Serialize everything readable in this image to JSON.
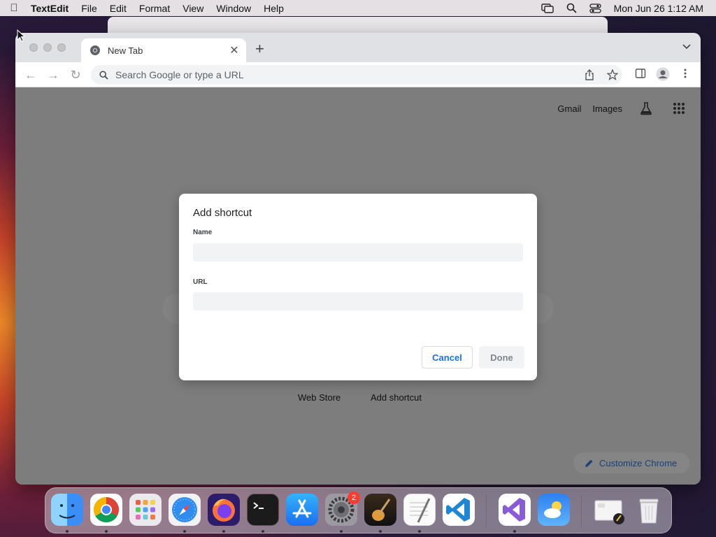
{
  "menubar": {
    "app_name": "TextEdit",
    "items": [
      "File",
      "Edit",
      "Format",
      "View",
      "Window",
      "Help"
    ],
    "clock": "Mon Jun 26  1:12 AM"
  },
  "browser": {
    "tab_title": "New Tab",
    "omnibox_placeholder": "Search Google or type a URL",
    "top_links": {
      "gmail": "Gmail",
      "images": "Images"
    },
    "bottom_links": {
      "web_store": "Web Store",
      "add_shortcut": "Add shortcut"
    },
    "customize_label": "Customize Chrome"
  },
  "dialog": {
    "title": "Add shortcut",
    "name_label": "Name",
    "name_value": "",
    "url_label": "URL",
    "url_value": "",
    "cancel_label": "Cancel",
    "done_label": "Done"
  },
  "dock": {
    "apps": [
      "finder",
      "chrome",
      "launchpad",
      "safari",
      "firefox",
      "terminal",
      "app-store",
      "system-settings",
      "garageband",
      "textedit",
      "vscode",
      "visual-studio",
      "weather",
      "downloads",
      "trash"
    ],
    "system_settings_badge": "2"
  },
  "colors": {
    "accent": "#1a73e8",
    "badge": "#ff3b30"
  }
}
